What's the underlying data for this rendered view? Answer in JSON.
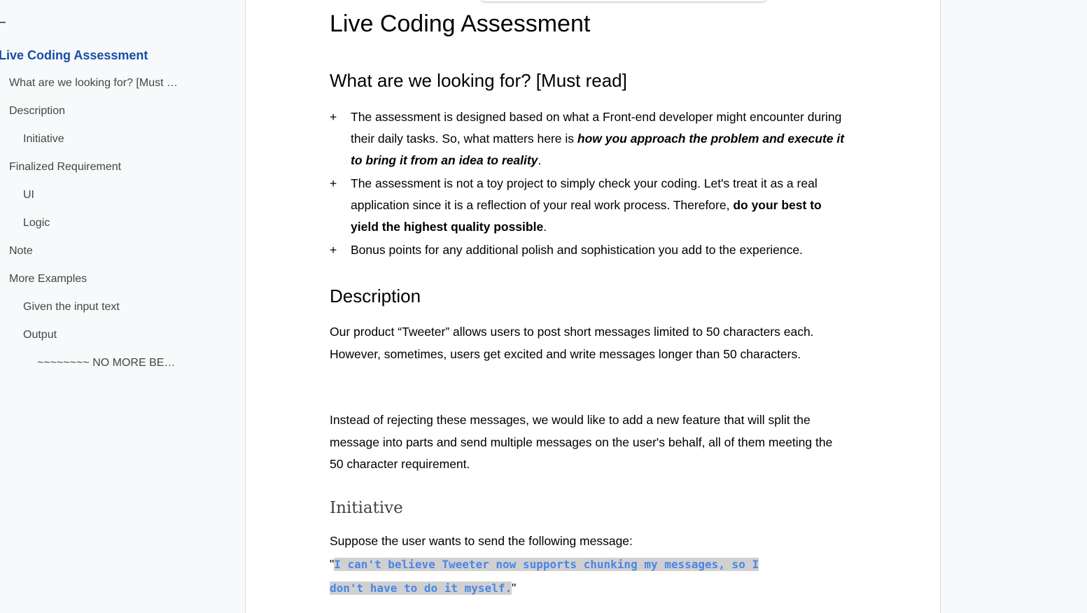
{
  "outline": {
    "items": [
      {
        "label": "Live Coding Assessment"
      },
      {
        "label": "What are we looking for? [Must …"
      },
      {
        "label": "Description"
      },
      {
        "label": "Initiative"
      },
      {
        "label": "Finalized Requirement"
      },
      {
        "label": "UI"
      },
      {
        "label": "Logic"
      },
      {
        "label": "Note"
      },
      {
        "label": "More Examples"
      },
      {
        "label": "Given the input text"
      },
      {
        "label": "Output"
      },
      {
        "label": "~~~~~~~~ NO MORE BE…"
      }
    ]
  },
  "doc": {
    "title": "Live Coding Assessment",
    "section1": {
      "heading": "What are we looking for? [Must read]",
      "bullet_mark": "+",
      "bullets": [
        {
          "pre": "The assessment is designed based on what a Front-end developer might encounter during their daily tasks. So, what matters here is ",
          "emph": "how you approach the problem and execute it to bring it from an idea to reality",
          "post": "."
        },
        {
          "pre": "The assessment is not a toy project to simply check your coding. Let's treat it as a real application since it is a reflection of your real work process. Therefore, ",
          "emph": "do your best to yield the highest quality possible",
          "post": "."
        },
        {
          "pre": "Bonus points for any additional polish and sophistication you add to the experience.",
          "emph": "",
          "post": ""
        }
      ]
    },
    "section2": {
      "heading": "Description",
      "para1": "Our product “Tweeter” allows users to post short messages limited to 50 characters each. However, sometimes, users get excited and write messages longer than 50 characters.",
      "para2": "Instead of rejecting these messages, we would like to add a new feature that will split the message into parts and send multiple messages on the user's behalf, all of them meeting the 50 character requirement."
    },
    "section3": {
      "heading": "Initiative",
      "intro": "Suppose the user wants to send the following message:",
      "quote_open": "\"",
      "code_line1": "I can't believe Tweeter now supports chunking my messages, so I",
      "code_line2": "don't have to do it myself.",
      "quote_close": "\""
    }
  },
  "colors": {
    "outline_active": "#174ea6",
    "code_text": "#4a86e8",
    "code_highlight": "#d0d0d0"
  }
}
